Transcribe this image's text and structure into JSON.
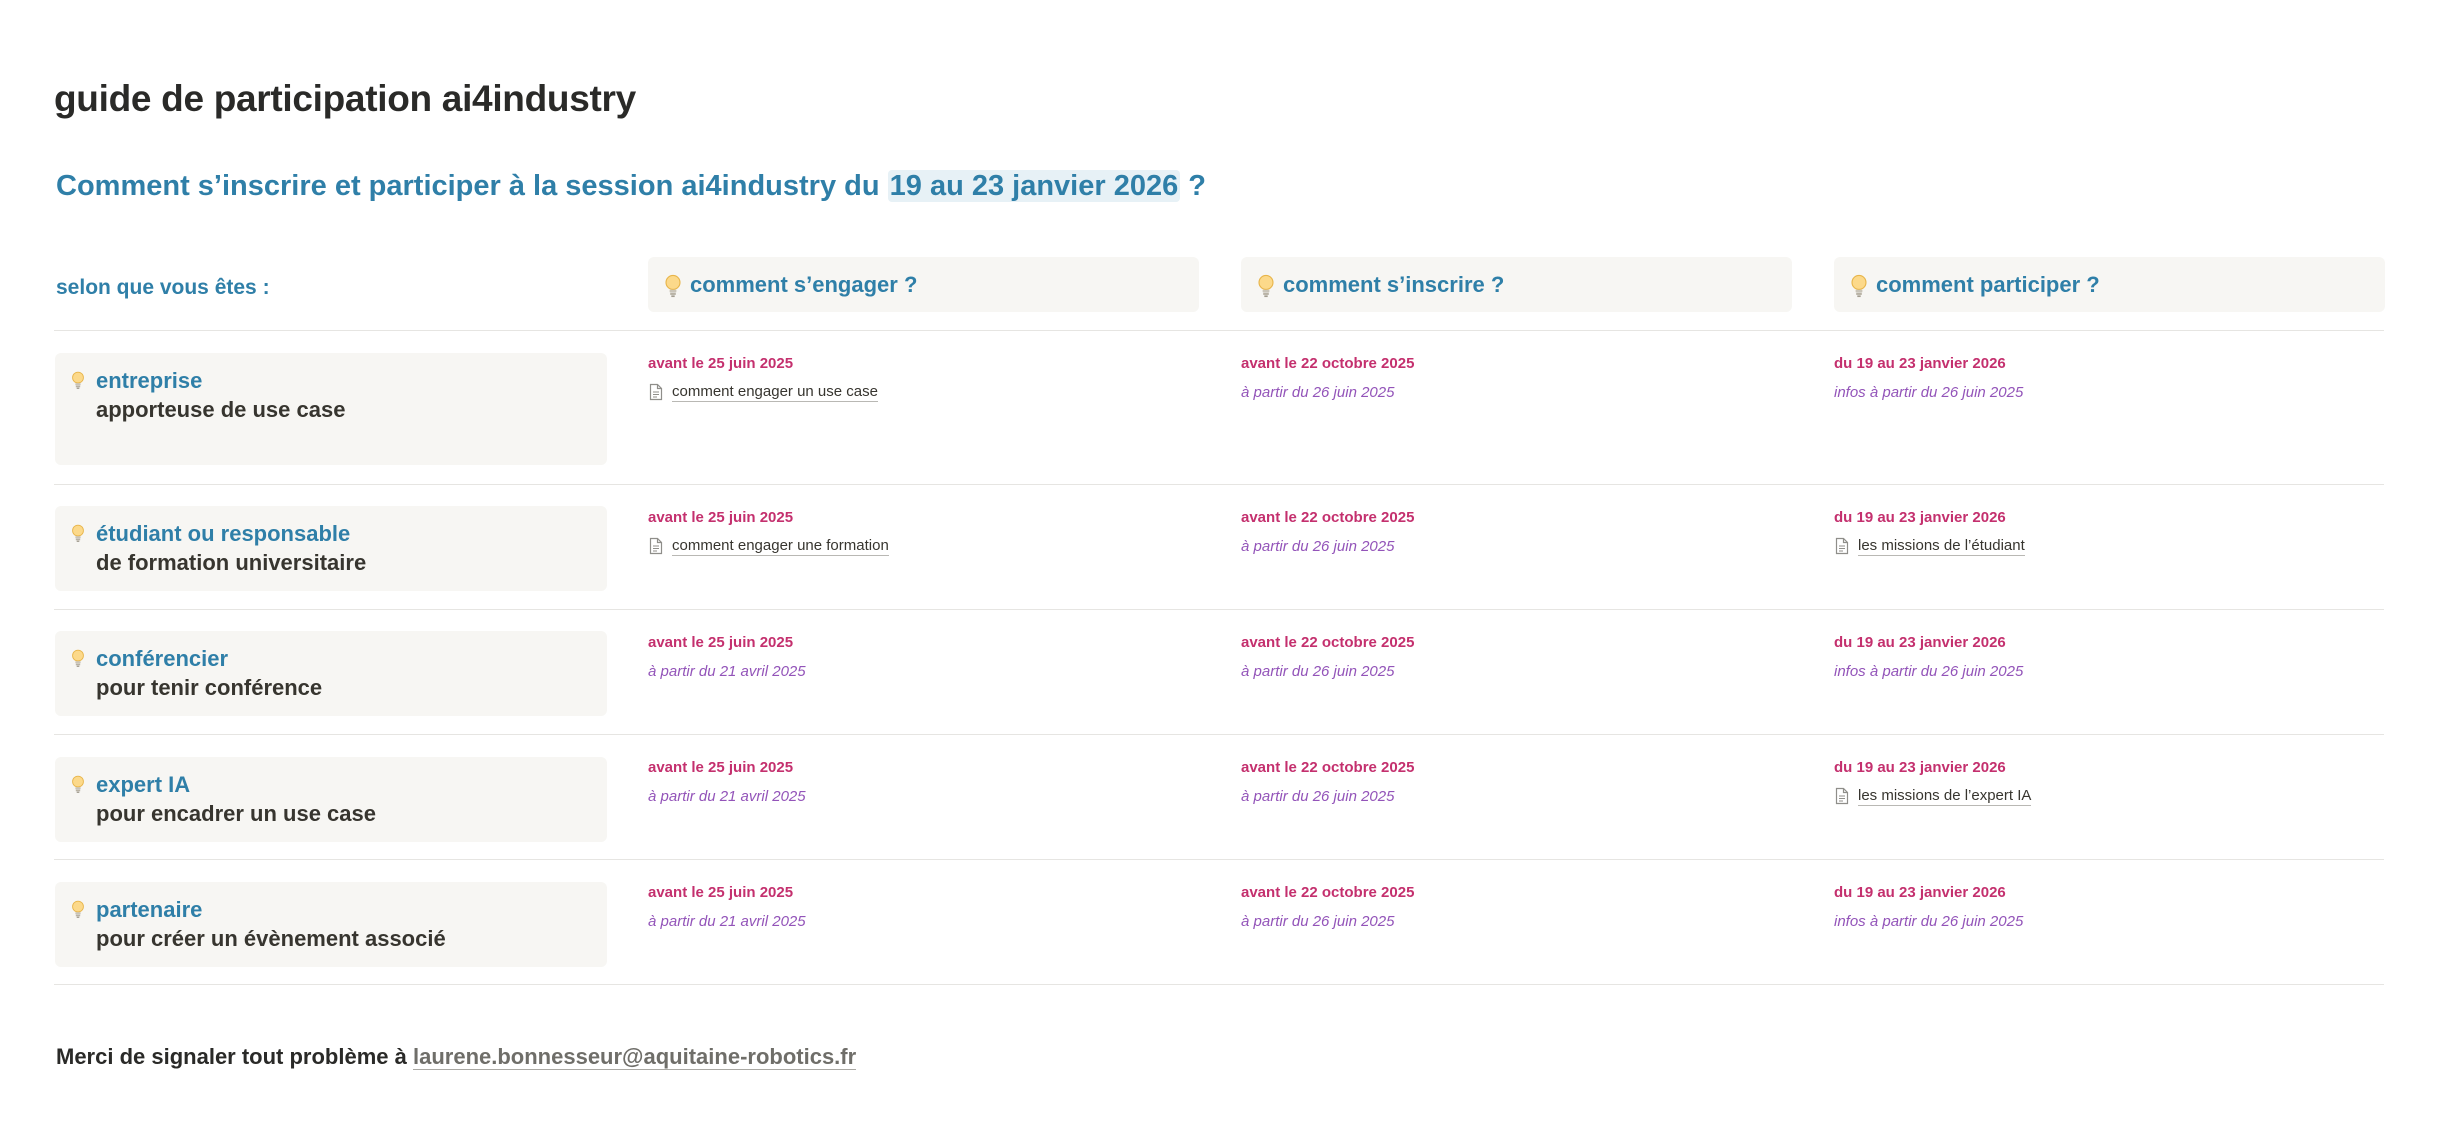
{
  "page": {
    "title": "guide de participation ai4industry",
    "subtitle_prefix": "Comment s’inscrire et participer à la session ai4industry du ",
    "subtitle_highlight": "19 au 23 janvier 2026",
    "subtitle_suffix": " ?"
  },
  "table": {
    "selon_label": "selon que vous êtes :",
    "columns": [
      "comment s’engager ?",
      "comment s’inscrire ?",
      "comment participer ?"
    ],
    "rows": [
      {
        "role": "entreprise",
        "desc": "apporteuse de  use case",
        "engager": {
          "deadline": "avant le 25 juin 2025",
          "link": "comment engager un use case"
        },
        "inscrire": {
          "deadline": "avant le 22 octobre 2025",
          "note": "à partir du 26 juin 2025"
        },
        "participer": {
          "deadline": "du 19 au 23 janvier 2026",
          "note": "infos à partir du 26 juin 2025"
        }
      },
      {
        "role": "étudiant ou responsable",
        "desc": "de formation universitaire",
        "engager": {
          "deadline": "avant le 25 juin 2025",
          "link": "comment engager une formation"
        },
        "inscrire": {
          "deadline": "avant le 22 octobre 2025",
          "note": "à partir du 26 juin 2025"
        },
        "participer": {
          "deadline": "du 19 au 23 janvier 2026",
          "link": "les missions de l’étudiant"
        }
      },
      {
        "role": "conférencier",
        "desc": "pour tenir conférence",
        "engager": {
          "deadline": "avant le 25 juin 2025",
          "note": "à partir du 21 avril 2025"
        },
        "inscrire": {
          "deadline": "avant le 22 octobre 2025",
          "note": "à partir du 26 juin 2025"
        },
        "participer": {
          "deadline": "du 19 au 23 janvier 2026",
          "note": "infos à partir du 26 juin 2025"
        }
      },
      {
        "role": "expert IA",
        "desc": "pour encadrer un use case",
        "engager": {
          "deadline": "avant le 25 juin 2025",
          "note": "à partir du 21 avril 2025"
        },
        "inscrire": {
          "deadline": "avant le 22 octobre 2025",
          "note": "à partir du 26 juin 2025"
        },
        "participer": {
          "deadline": "du 19 au 23 janvier 2026",
          "link": "les missions de l’expert IA"
        }
      },
      {
        "role": "partenaire",
        "desc": "pour créer un évènement associé",
        "engager": {
          "deadline": "avant le 25 juin 2025",
          "note": "à partir du 21 avril 2025"
        },
        "inscrire": {
          "deadline": "avant le 22 octobre 2025",
          "note": "à partir du 26 juin 2025"
        },
        "participer": {
          "deadline": "du 19 au 23 janvier 2026",
          "note": "infos à partir du 26 juin 2025"
        }
      }
    ]
  },
  "footer": {
    "text": "Merci de signaler tout problème à ",
    "email": "laurene.bonnesseur@aquitaine-robotics.fr"
  },
  "icons": {
    "bulb": "lightbulb-icon",
    "doc": "document-icon"
  },
  "colors": {
    "accent_blue": "#2f7fa8",
    "deadline_magenta": "#c4306e",
    "note_purple": "#9354b9"
  }
}
